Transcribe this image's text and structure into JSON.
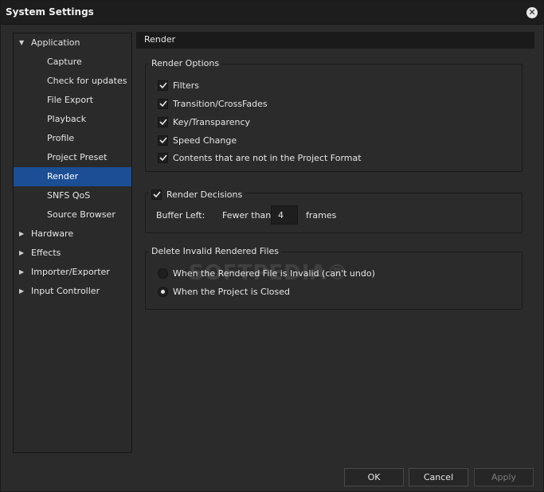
{
  "window": {
    "title": "System Settings"
  },
  "sidebar": {
    "items": [
      {
        "label": "Application",
        "expanded": true
      },
      {
        "label": "Capture"
      },
      {
        "label": "Check for updates"
      },
      {
        "label": "File Export"
      },
      {
        "label": "Playback"
      },
      {
        "label": "Profile"
      },
      {
        "label": "Project Preset"
      },
      {
        "label": "Render",
        "selected": true
      },
      {
        "label": "SNFS QoS"
      },
      {
        "label": "Source Browser"
      },
      {
        "label": "Hardware",
        "expanded": false
      },
      {
        "label": "Effects",
        "expanded": false
      },
      {
        "label": "Importer/Exporter",
        "expanded": false
      },
      {
        "label": "Input Controller",
        "expanded": false
      }
    ]
  },
  "content": {
    "header": "Render",
    "render_options": {
      "title": "Render Options",
      "options": [
        {
          "label": "Filters",
          "checked": true
        },
        {
          "label": "Transition/CrossFades",
          "checked": true
        },
        {
          "label": "Key/Transparency",
          "checked": true
        },
        {
          "label": "Speed Change",
          "checked": true
        },
        {
          "label": "Contents that are not in the Project Format",
          "checked": true
        }
      ]
    },
    "render_decisions": {
      "title": "Render Decisions",
      "checked": true,
      "buffer_label": "Buffer Left:",
      "fewer_than": "Fewer than",
      "value": "4",
      "unit": "frames"
    },
    "delete_invalid": {
      "title": "Delete Invalid Rendered Files",
      "options": [
        {
          "label": "When the Rendered File is Invalid (can't undo)",
          "selected": false
        },
        {
          "label": "When the Project is Closed",
          "selected": true
        }
      ]
    }
  },
  "buttons": {
    "ok": "OK",
    "cancel": "Cancel",
    "apply": "Apply",
    "apply_enabled": false
  },
  "watermark": "SOFTPEDIA®",
  "colors": {
    "selection": "#1b4e94",
    "background": "#2b2b2b",
    "titlebar": "#1d1d1d"
  }
}
